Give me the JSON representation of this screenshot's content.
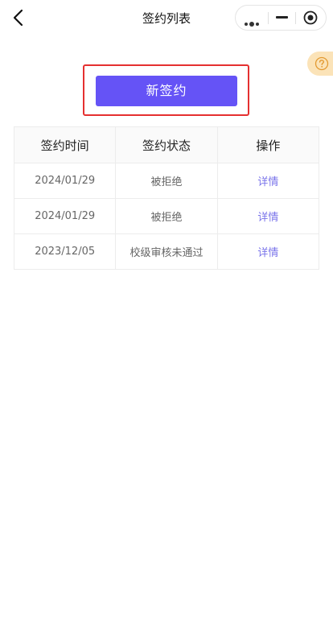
{
  "nav": {
    "title": "签约列表"
  },
  "icons": {
    "back": "chevron-left-icon",
    "more": "more-dots-icon",
    "minimize": "minus-icon",
    "close": "target-circle-icon",
    "help": "question-circle-icon"
  },
  "colors": {
    "accent": "#6553f6",
    "highlight_box": "#e53030",
    "link": "#7a74ea",
    "help_tab_bg": "#fbe3b8",
    "help_icon": "#e39a32"
  },
  "new_button": {
    "label": "新签约"
  },
  "table": {
    "headers": [
      "签约时间",
      "签约状态",
      "操作"
    ],
    "rows": [
      {
        "time": "2024/01/29",
        "status": "被拒绝",
        "action": "详情"
      },
      {
        "time": "2024/01/29",
        "status": "被拒绝",
        "action": "详情"
      },
      {
        "time": "2023/12/05",
        "status": "校级审核未通过",
        "action": "详情"
      }
    ]
  }
}
